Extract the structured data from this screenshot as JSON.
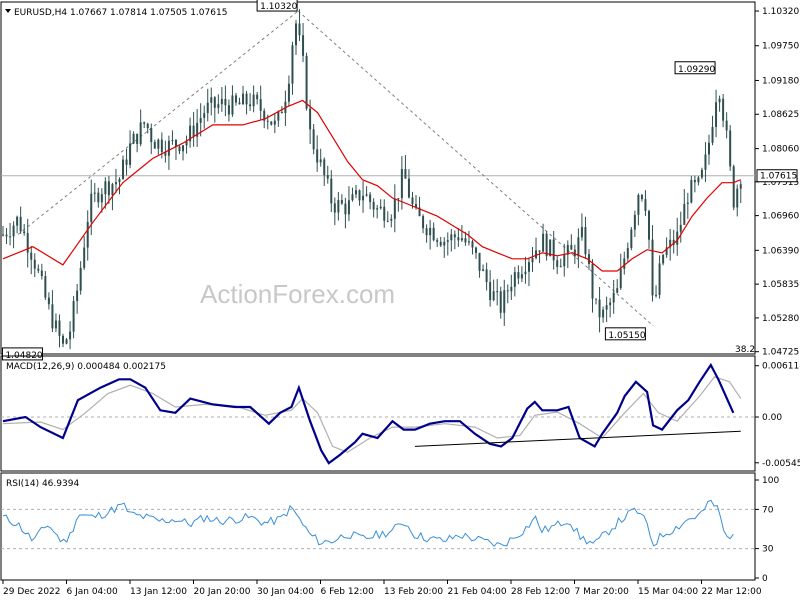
{
  "watermark": "ActionForex.com",
  "colors": {
    "candle": "#2f4f4f",
    "ma": "#e00000",
    "macd": "#00008b",
    "signal": "#b0b0b0",
    "rsi": "#3a8fd8",
    "frame": "#000000",
    "dash": "#808080",
    "level": "#b0b0b0"
  },
  "chart_data": [
    {
      "type": "candlestick",
      "title": "EURUSD,H4  1.07667 1.07814 1.07505 1.07615",
      "symbol": "EURUSD,H4",
      "ohlc": {
        "open": 1.07667,
        "high": 1.07814,
        "low": 1.07505,
        "close": 1.07615
      },
      "current_price_label": "1.07615",
      "fib_label": "38.2",
      "ylim": [
        1.0472,
        1.1037
      ],
      "y_ticks": [
        "1.10320",
        "1.09750",
        "1.09180",
        "1.08625",
        "1.08060",
        "1.07515",
        "1.06960",
        "1.06390",
        "1.05835",
        "1.05280",
        "1.04725"
      ],
      "annotations": [
        {
          "label": "1.04820",
          "value": 1.0482,
          "date": "5 Jan"
        },
        {
          "label": "1.10320",
          "value": 1.1032,
          "date": "2 Feb"
        },
        {
          "label": "1.05150",
          "value": 1.0515,
          "date": "15 Mar"
        },
        {
          "label": "1.09290",
          "value": 1.0929,
          "date": "23 Mar"
        }
      ],
      "trend_lines": [
        {
          "from": [
            0.02,
            1.0665
          ],
          "to": [
            0.394,
            1.1032
          ]
        },
        {
          "from": [
            0.394,
            1.1032
          ],
          "to": [
            0.868,
            1.0515
          ]
        }
      ],
      "close_series": [
        [
          0.0,
          1.0665
        ],
        [
          0.02,
          1.069
        ],
        [
          0.04,
          1.063
        ],
        [
          0.06,
          1.0545
        ],
        [
          0.08,
          1.048
        ],
        [
          0.09,
          1.051
        ],
        [
          0.1,
          1.058
        ],
        [
          0.115,
          1.071
        ],
        [
          0.13,
          1.074
        ],
        [
          0.155,
          1.0755
        ],
        [
          0.17,
          1.081
        ],
        [
          0.19,
          1.085
        ],
        [
          0.2,
          1.082
        ],
        [
          0.22,
          1.081
        ],
        [
          0.245,
          1.082
        ],
        [
          0.27,
          1.087
        ],
        [
          0.295,
          1.088
        ],
        [
          0.31,
          1.0875
        ],
        [
          0.33,
          1.0885
        ],
        [
          0.35,
          1.0865
        ],
        [
          0.365,
          1.084
        ],
        [
          0.38,
          1.091
        ],
        [
          0.39,
          1.102
        ],
        [
          0.4,
          1.095
        ],
        [
          0.41,
          1.083
        ],
        [
          0.425,
          1.0775
        ],
        [
          0.44,
          1.0715
        ],
        [
          0.46,
          1.071
        ],
        [
          0.48,
          1.0735
        ],
        [
          0.5,
          1.0705
        ],
        [
          0.52,
          1.0705
        ],
        [
          0.535,
          1.0765
        ],
        [
          0.55,
          1.0695
        ],
        [
          0.57,
          1.0675
        ],
        [
          0.59,
          1.0655
        ],
        [
          0.61,
          1.0665
        ],
        [
          0.63,
          1.063
        ],
        [
          0.65,
          1.0575
        ],
        [
          0.665,
          1.0545
        ],
        [
          0.68,
          1.0595
        ],
        [
          0.7,
          1.0625
        ],
        [
          0.72,
          1.0655
        ],
        [
          0.74,
          1.0625
        ],
        [
          0.76,
          1.0635
        ],
        [
          0.775,
          1.0665
        ],
        [
          0.79,
          1.0545
        ],
        [
          0.8,
          1.053
        ],
        [
          0.82,
          1.057
        ],
        [
          0.835,
          1.066
        ],
        [
          0.85,
          1.0745
        ],
        [
          0.86,
          1.071
        ],
        [
          0.868,
          1.0535
        ],
        [
          0.88,
          1.063
        ],
        [
          0.9,
          1.066
        ],
        [
          0.915,
          1.0735
        ],
        [
          0.93,
          1.0745
        ],
        [
          0.94,
          1.0795
        ],
        [
          0.955,
          1.092
        ],
        [
          0.965,
          1.0835
        ],
        [
          0.975,
          1.072
        ],
        [
          0.985,
          1.0765
        ]
      ],
      "ma_series": [
        [
          0.0,
          1.0625
        ],
        [
          0.04,
          1.0645
        ],
        [
          0.08,
          1.0615
        ],
        [
          0.12,
          1.0685
        ],
        [
          0.16,
          1.075
        ],
        [
          0.2,
          1.079
        ],
        [
          0.24,
          1.0815
        ],
        [
          0.28,
          1.0845
        ],
        [
          0.32,
          1.0845
        ],
        [
          0.35,
          1.0855
        ],
        [
          0.38,
          1.0875
        ],
        [
          0.4,
          1.0885
        ],
        [
          0.42,
          1.0865
        ],
        [
          0.44,
          1.0825
        ],
        [
          0.46,
          1.0785
        ],
        [
          0.48,
          1.0755
        ],
        [
          0.5,
          1.0745
        ],
        [
          0.52,
          1.0725
        ],
        [
          0.54,
          1.0715
        ],
        [
          0.56,
          1.0705
        ],
        [
          0.58,
          1.0695
        ],
        [
          0.6,
          1.068
        ],
        [
          0.62,
          1.0665
        ],
        [
          0.64,
          1.0645
        ],
        [
          0.66,
          1.0635
        ],
        [
          0.68,
          1.0625
        ],
        [
          0.7,
          1.0625
        ],
        [
          0.72,
          1.0635
        ],
        [
          0.74,
          1.063
        ],
        [
          0.76,
          1.0635
        ],
        [
          0.78,
          1.0625
        ],
        [
          0.8,
          1.0605
        ],
        [
          0.82,
          1.0605
        ],
        [
          0.84,
          1.0625
        ],
        [
          0.86,
          1.064
        ],
        [
          0.88,
          1.0635
        ],
        [
          0.9,
          1.0655
        ],
        [
          0.92,
          1.0695
        ],
        [
          0.94,
          1.0725
        ],
        [
          0.96,
          1.075
        ],
        [
          0.975,
          1.075
        ],
        [
          0.985,
          1.0755
        ]
      ],
      "x_ticks": [
        "29 Dec 2022",
        "6 Jan 04:00",
        "13 Jan 12:00",
        "20 Jan 20:00",
        "30 Jan 04:00",
        "6 Feb 12:00",
        "13 Feb 20:00",
        "21 Feb 04:00",
        "28 Feb 12:00",
        "7 Mar 20:00",
        "15 Mar 04:00",
        "22 Mar 12:00"
      ]
    },
    {
      "type": "line",
      "title": "MACD(12,26,9) 0.000484 0.002175",
      "label": "MACD(12,26,9)",
      "values_text": "0.000484 0.002175",
      "ylim": [
        -0.0062,
        0.0068
      ],
      "y_ticks": [
        "0.006118",
        "0.00",
        "-0.005458"
      ],
      "macd": [
        [
          0.0,
          -0.0005
        ],
        [
          0.03,
          0.0
        ],
        [
          0.05,
          -0.0012
        ],
        [
          0.08,
          -0.0025
        ],
        [
          0.1,
          0.002
        ],
        [
          0.13,
          0.0035
        ],
        [
          0.155,
          0.0045
        ],
        [
          0.17,
          0.0045
        ],
        [
          0.19,
          0.0035
        ],
        [
          0.21,
          0.0008
        ],
        [
          0.23,
          0.0005
        ],
        [
          0.25,
          0.0022
        ],
        [
          0.28,
          0.0015
        ],
        [
          0.31,
          0.0012
        ],
        [
          0.33,
          0.0012
        ],
        [
          0.355,
          -0.0008
        ],
        [
          0.37,
          0.0005
        ],
        [
          0.385,
          0.0012
        ],
        [
          0.395,
          0.0035
        ],
        [
          0.41,
          -0.0005
        ],
        [
          0.425,
          -0.004
        ],
        [
          0.435,
          -0.0055
        ],
        [
          0.45,
          -0.0045
        ],
        [
          0.47,
          -0.003
        ],
        [
          0.48,
          -0.002
        ],
        [
          0.5,
          -0.0025
        ],
        [
          0.52,
          -0.0005
        ],
        [
          0.535,
          -0.0015
        ],
        [
          0.55,
          -0.0015
        ],
        [
          0.57,
          -0.0008
        ],
        [
          0.59,
          -0.0005
        ],
        [
          0.61,
          -0.0005
        ],
        [
          0.63,
          -0.002
        ],
        [
          0.65,
          -0.0032
        ],
        [
          0.665,
          -0.0035
        ],
        [
          0.68,
          -0.0025
        ],
        [
          0.7,
          0.001
        ],
        [
          0.71,
          0.0018
        ],
        [
          0.72,
          0.0008
        ],
        [
          0.74,
          0.0008
        ],
        [
          0.755,
          0.0012
        ],
        [
          0.77,
          -0.0025
        ],
        [
          0.79,
          -0.0035
        ],
        [
          0.8,
          -0.002
        ],
        [
          0.82,
          0.0005
        ],
        [
          0.83,
          0.0025
        ],
        [
          0.845,
          0.0042
        ],
        [
          0.86,
          0.003
        ],
        [
          0.868,
          -0.001
        ],
        [
          0.88,
          -0.0015
        ],
        [
          0.9,
          0.0008
        ],
        [
          0.915,
          0.002
        ],
        [
          0.93,
          0.0042
        ],
        [
          0.945,
          0.0062
        ],
        [
          0.955,
          0.0045
        ],
        [
          0.965,
          0.0025
        ],
        [
          0.975,
          0.0005
        ]
      ],
      "signal": [
        [
          0.0,
          -0.0008
        ],
        [
          0.05,
          -0.0006
        ],
        [
          0.08,
          -0.0015
        ],
        [
          0.11,
          0.0005
        ],
        [
          0.14,
          0.0028
        ],
        [
          0.17,
          0.0038
        ],
        [
          0.2,
          0.0028
        ],
        [
          0.23,
          0.0012
        ],
        [
          0.27,
          0.0015
        ],
        [
          0.31,
          0.0013
        ],
        [
          0.35,
          0.0002
        ],
        [
          0.385,
          0.0008
        ],
        [
          0.4,
          0.0022
        ],
        [
          0.42,
          0.0005
        ],
        [
          0.44,
          -0.0035
        ],
        [
          0.46,
          -0.0042
        ],
        [
          0.49,
          -0.0025
        ],
        [
          0.52,
          -0.0012
        ],
        [
          0.55,
          -0.0012
        ],
        [
          0.59,
          -0.0008
        ],
        [
          0.63,
          -0.0012
        ],
        [
          0.66,
          -0.0025
        ],
        [
          0.69,
          -0.0022
        ],
        [
          0.71,
          0.0002
        ],
        [
          0.74,
          0.0006
        ],
        [
          0.77,
          -0.0008
        ],
        [
          0.8,
          -0.0025
        ],
        [
          0.83,
          0.0005
        ],
        [
          0.855,
          0.0028
        ],
        [
          0.875,
          0.0005
        ],
        [
          0.9,
          -0.0005
        ],
        [
          0.93,
          0.0025
        ],
        [
          0.95,
          0.0048
        ],
        [
          0.97,
          0.0042
        ],
        [
          0.985,
          0.0022
        ]
      ],
      "trend_line": {
        "from": [
          0.55,
          -0.0035
        ],
        "to": [
          0.985,
          -0.0017
        ]
      }
    },
    {
      "type": "line",
      "title": "RSI(14) 46.9394",
      "label": "RSI(14)",
      "value_text": "46.9394",
      "ylim": [
        0,
        100
      ],
      "y_ticks": [
        "100",
        "70",
        "30",
        "0"
      ],
      "levels": [
        70,
        30
      ],
      "rsi": [
        [
          0.0,
          62
        ],
        [
          0.02,
          55
        ],
        [
          0.04,
          38
        ],
        [
          0.06,
          55
        ],
        [
          0.08,
          36
        ],
        [
          0.09,
          44
        ],
        [
          0.1,
          65
        ],
        [
          0.12,
          62
        ],
        [
          0.14,
          67
        ],
        [
          0.16,
          75
        ],
        [
          0.17,
          65
        ],
        [
          0.19,
          62
        ],
        [
          0.21,
          58
        ],
        [
          0.23,
          60
        ],
        [
          0.25,
          55
        ],
        [
          0.27,
          62
        ],
        [
          0.29,
          58
        ],
        [
          0.31,
          60
        ],
        [
          0.33,
          62
        ],
        [
          0.35,
          56
        ],
        [
          0.37,
          60
        ],
        [
          0.385,
          72
        ],
        [
          0.4,
          55
        ],
        [
          0.41,
          44
        ],
        [
          0.425,
          36
        ],
        [
          0.44,
          38
        ],
        [
          0.46,
          45
        ],
        [
          0.48,
          40
        ],
        [
          0.5,
          44
        ],
        [
          0.52,
          48
        ],
        [
          0.535,
          58
        ],
        [
          0.55,
          44
        ],
        [
          0.57,
          40
        ],
        [
          0.59,
          38
        ],
        [
          0.61,
          44
        ],
        [
          0.63,
          40
        ],
        [
          0.65,
          36
        ],
        [
          0.665,
          33
        ],
        [
          0.68,
          40
        ],
        [
          0.7,
          52
        ],
        [
          0.71,
          62
        ],
        [
          0.72,
          48
        ],
        [
          0.74,
          54
        ],
        [
          0.755,
          60
        ],
        [
          0.77,
          42
        ],
        [
          0.79,
          34
        ],
        [
          0.8,
          42
        ],
        [
          0.82,
          56
        ],
        [
          0.83,
          62
        ],
        [
          0.845,
          70
        ],
        [
          0.86,
          55
        ],
        [
          0.868,
          34
        ],
        [
          0.88,
          44
        ],
        [
          0.9,
          52
        ],
        [
          0.915,
          60
        ],
        [
          0.93,
          64
        ],
        [
          0.945,
          78
        ],
        [
          0.955,
          70
        ],
        [
          0.965,
          40
        ],
        [
          0.975,
          47
        ]
      ]
    }
  ]
}
